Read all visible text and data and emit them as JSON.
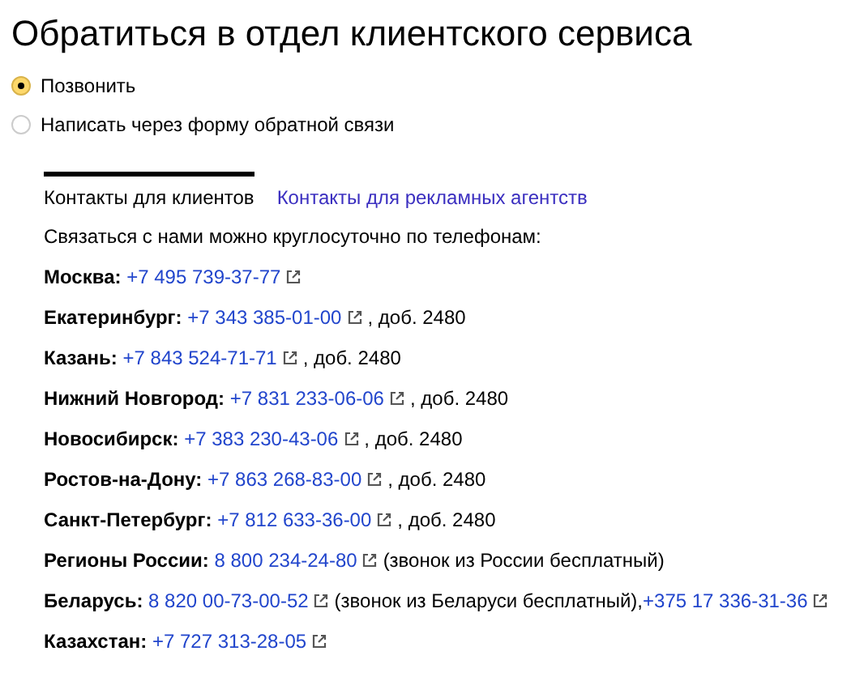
{
  "title": "Обратиться в отдел клиентского сервиса",
  "options": [
    {
      "label": "Позвонить",
      "selected": true
    },
    {
      "label": "Написать через форму обратной связи",
      "selected": false
    }
  ],
  "tabs": [
    {
      "label": "Контакты для клиентов",
      "selected": true
    },
    {
      "label": "Контакты для рекламных агентств",
      "selected": false
    }
  ],
  "intro": "Связаться с нами можно круглосуточно по телефонам:",
  "contacts": [
    {
      "city": "Москва:",
      "parts": [
        {
          "kind": "link",
          "text": "+7 495 739-37-77"
        }
      ]
    },
    {
      "city": "Екатеринбург:",
      "parts": [
        {
          "kind": "link",
          "text": "+7 343 385-01-00"
        },
        {
          "kind": "text",
          "text": ", доб. 2480"
        }
      ]
    },
    {
      "city": "Казань:",
      "parts": [
        {
          "kind": "link",
          "text": "+7 843 524-71-71"
        },
        {
          "kind": "text",
          "text": ", доб. 2480"
        }
      ]
    },
    {
      "city": "Нижний Новгород:",
      "parts": [
        {
          "kind": "link",
          "text": "+7 831 233-06-06"
        },
        {
          "kind": "text",
          "text": ", доб. 2480"
        }
      ]
    },
    {
      "city": "Новосибирск:",
      "parts": [
        {
          "kind": "link",
          "text": "+7 383 230-43-06"
        },
        {
          "kind": "text",
          "text": ", доб. 2480"
        }
      ]
    },
    {
      "city": "Ростов-на-Дону:",
      "parts": [
        {
          "kind": "link",
          "text": "+7 863 268-83-00"
        },
        {
          "kind": "text",
          "text": ", доб. 2480"
        }
      ]
    },
    {
      "city": "Санкт-Петербург:",
      "parts": [
        {
          "kind": "link",
          "text": "+7 812 633-36-00"
        },
        {
          "kind": "text",
          "text": ", доб. 2480"
        }
      ]
    },
    {
      "city": "Регионы России:",
      "parts": [
        {
          "kind": "link",
          "text": "8 800 234-24-80"
        },
        {
          "kind": "text",
          "text": "(звонок из России бесплатный)"
        }
      ]
    },
    {
      "city": "Беларусь:",
      "parts": [
        {
          "kind": "link",
          "text": "8 820 00-73-00-52"
        },
        {
          "kind": "text",
          "text": "(звонок из Беларуси бесплатный),"
        },
        {
          "kind": "link",
          "text": "+375 17 336-31-36"
        }
      ]
    },
    {
      "city": "Казахстан:",
      "parts": [
        {
          "kind": "link",
          "text": "+7 727 313-28-05"
        }
      ]
    }
  ]
}
